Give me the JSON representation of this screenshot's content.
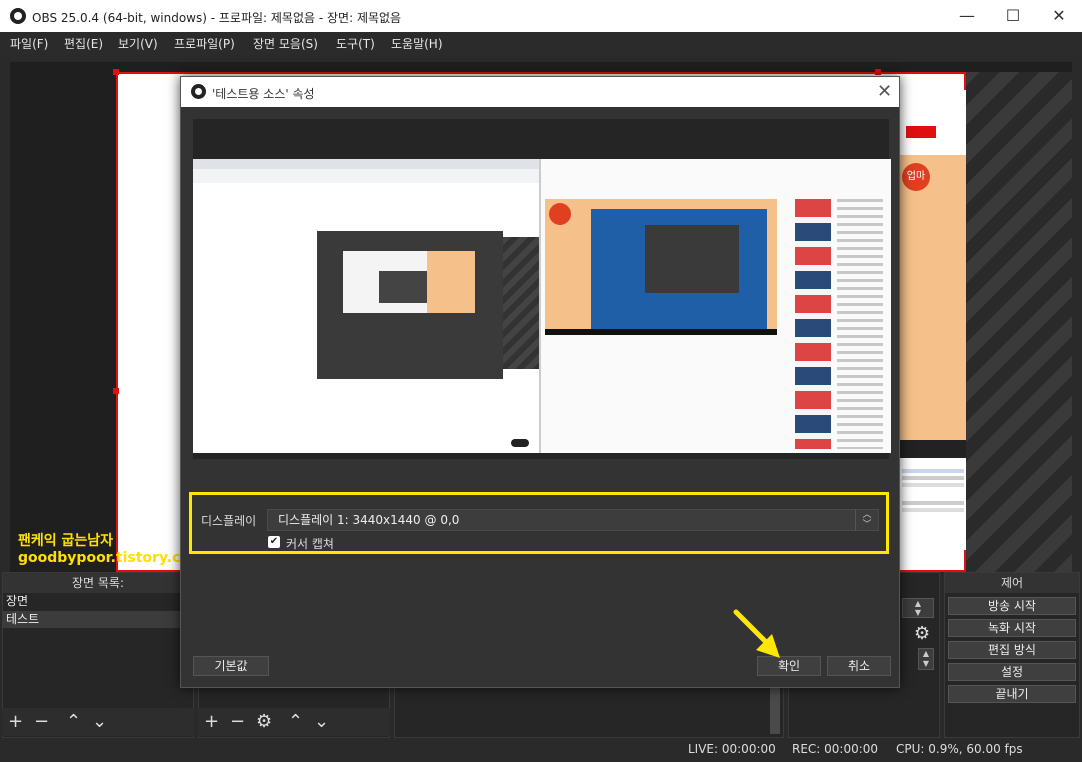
{
  "window": {
    "title": "OBS 25.0.4 (64-bit, windows) - 프로파일: 제목없음 - 장면: 제목없음",
    "minimize": "—",
    "maximize": "☐",
    "close": "✕"
  },
  "menu": [
    "파일(F)",
    "편집(E)",
    "보기(V)",
    "프로파일(P)",
    "장면 모음(S)",
    "도구(T)",
    "도움말(H)"
  ],
  "watermark": {
    "line1": "팬케익 굽는남자",
    "line2": "goodbypoor.tistory.com"
  },
  "preview": {
    "yt_badge": "업마"
  },
  "scenes": {
    "title": "장면 목록:",
    "items": [
      "장면",
      "테스트"
    ]
  },
  "controls": {
    "title": "제어",
    "buttons": [
      "방송 시작",
      "녹화 시작",
      "편집 방식",
      "설정",
      "끝내기"
    ]
  },
  "status": {
    "live": "LIVE: 00:00:00",
    "rec": "REC: 00:00:00",
    "cpu": "CPU: 0.9%, 60.00 fps"
  },
  "dialog": {
    "title": "'테스트용 소스' 속성",
    "display_label": "디스플레이",
    "display_value": "디스플레이 1: 3440x1440 @ 0,0",
    "cursor_label": "커서 캡쳐",
    "cursor_checked": true,
    "defaults_button": "기본값",
    "ok_button": "확인",
    "cancel_button": "취소"
  },
  "colors": {
    "accent_yellow": "#ffe800",
    "frame_red": "#e01010"
  },
  "icons": [
    "obs-logo-icon",
    "plus-icon",
    "minus-icon",
    "up-arrow-icon",
    "down-arrow-icon",
    "gear-icon",
    "close-icon"
  ]
}
